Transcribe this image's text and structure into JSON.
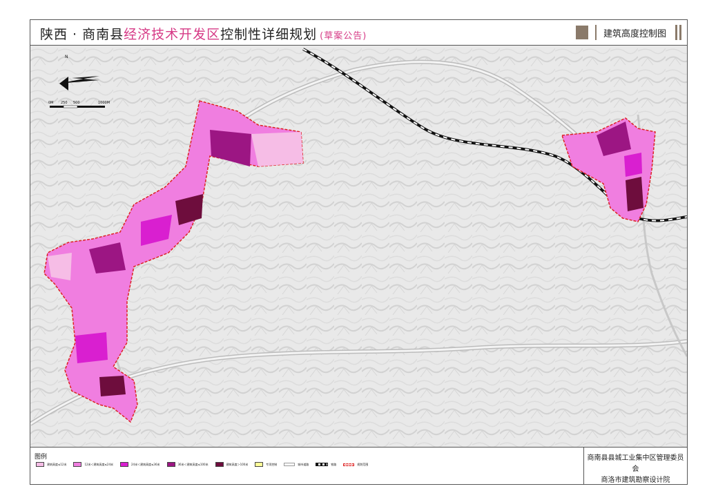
{
  "header": {
    "title_part1": "陕西 · 商南县",
    "title_accent": "经济技术开发区",
    "title_part2": "控制性详细规划",
    "title_draft": "(草案公告)",
    "map_name": "建筑高度控制图"
  },
  "map": {
    "north": "N",
    "scale_labels": [
      "0M",
      "250",
      "500",
      "1000M"
    ]
  },
  "legend": {
    "title": "图例",
    "items": [
      {
        "label": "建筑高度≤12米",
        "color": "#f6bde6"
      },
      {
        "label": "12米＜建筑高度≤24米",
        "color": "#f07ee0"
      },
      {
        "label": "24米＜建筑高度≤36米",
        "color": "#d91fd0"
      },
      {
        "label": "36米＜建筑高度≤100米",
        "color": "#9c1683"
      },
      {
        "label": "建筑高度＞100米",
        "color": "#6e0d3d"
      },
      {
        "label": "专项控制",
        "color": "#ffff99"
      },
      {
        "label": "城市道路",
        "type": "line"
      },
      {
        "label": "铁路",
        "type": "rail"
      },
      {
        "label": "规划范围",
        "type": "boundary"
      }
    ]
  },
  "org": {
    "line1": "商南县县城工业集中区管理委员会",
    "line2": "商洛市建筑勘察设计院"
  },
  "colors": {
    "accent": "#d63a86",
    "frame": "#8a7a6a"
  }
}
